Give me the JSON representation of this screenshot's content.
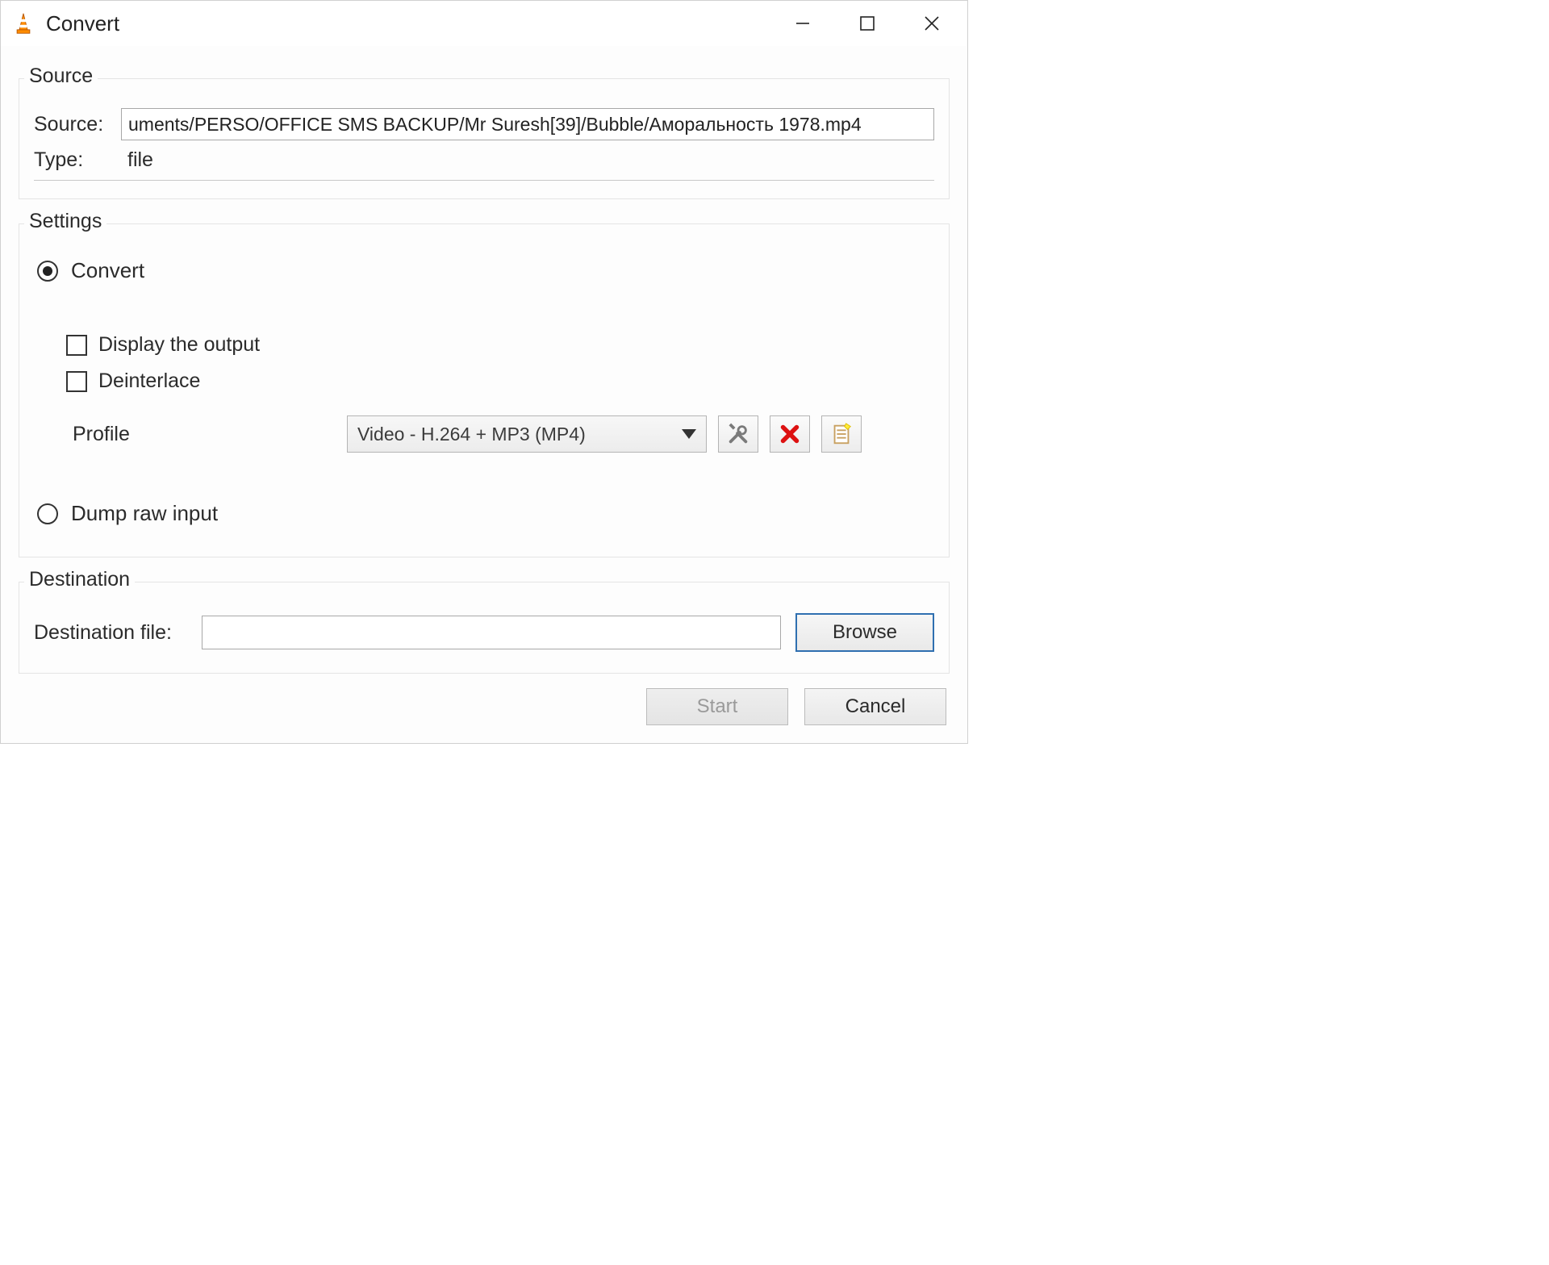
{
  "window": {
    "title": "Convert"
  },
  "source_group": {
    "legend": "Source",
    "source_label": "Source:",
    "source_value": "uments/PERSO/OFFICE SMS BACKUP/Mr Suresh[39]/Bubble/Аморальность 1978.mp4",
    "type_label": "Type:",
    "type_value": "file"
  },
  "settings_group": {
    "legend": "Settings",
    "convert_radio": "Convert",
    "display_output_check": "Display the output",
    "deinterlace_check": "Deinterlace",
    "profile_label": "Profile",
    "profile_value": "Video - H.264 + MP3 (MP4)",
    "dump_raw_radio": "Dump raw input",
    "icon_edit": "edit-profile",
    "icon_delete": "delete-profile",
    "icon_new": "new-profile"
  },
  "destination_group": {
    "legend": "Destination",
    "dest_label": "Destination file:",
    "dest_value": "",
    "browse_button": "Browse"
  },
  "buttons": {
    "start": "Start",
    "cancel": "Cancel"
  }
}
